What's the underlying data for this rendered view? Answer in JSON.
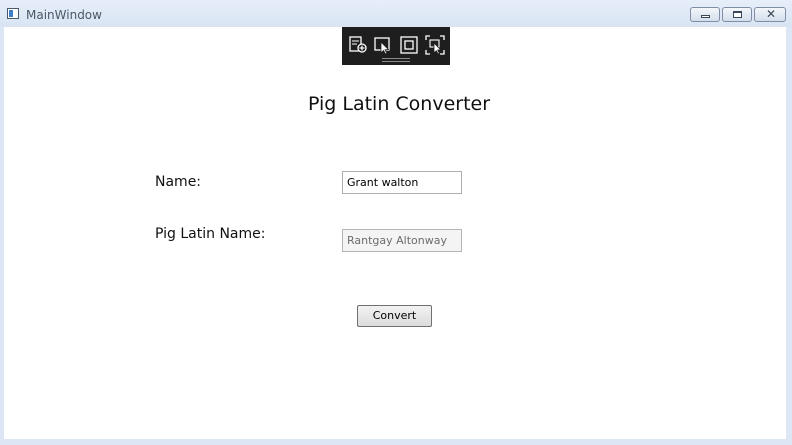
{
  "window": {
    "title": "MainWindow",
    "icon": "app-window-icon",
    "controls": [
      "minimize-icon",
      "maximize-icon",
      "close-icon"
    ]
  },
  "debug_toolbar": {
    "buttons": [
      "select-element-icon",
      "pointer-icon",
      "frame-icon",
      "zoom-select-icon"
    ]
  },
  "form": {
    "heading": "Pig Latin Converter",
    "name_label": "Name:",
    "name_value": "Grant walton",
    "piglatin_label": "Pig Latin Name:",
    "piglatin_value": "Rantgay Altonway",
    "convert_label": "Convert"
  },
  "colors": {
    "titlebar": "#dce6f4",
    "client_background": "#ffffff",
    "toolbar_background": "#1e1e1e"
  }
}
